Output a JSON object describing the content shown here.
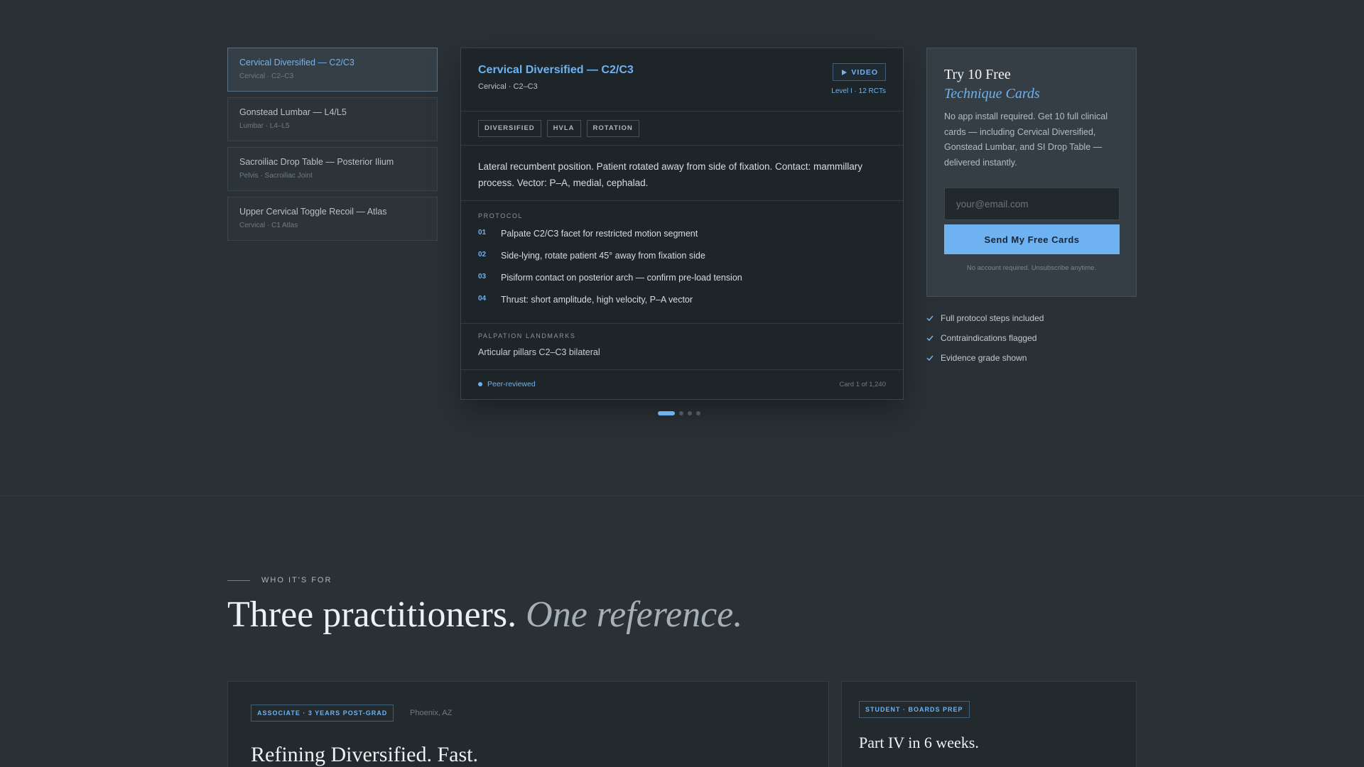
{
  "techniques": [
    {
      "title": "Cervical Diversified — C2/C3",
      "sub": "Cervical · C2–C3",
      "active": true
    },
    {
      "title": "Gonstead Lumbar — L4/L5",
      "sub": "Lumbar · L4–L5",
      "active": false
    },
    {
      "title": "Sacroiliac Drop Table — Posterior Ilium",
      "sub": "Pelvis · Sacroiliac Joint",
      "active": false
    },
    {
      "title": "Upper Cervical Toggle Recoil — Atlas",
      "sub": "Cervical · C1 Atlas",
      "active": false
    }
  ],
  "card": {
    "title": "Cervical Diversified — C2/C3",
    "subtitle": "Cervical · C2–C3",
    "video_label": "VIDEO",
    "level": "Level I · 12 RCTs",
    "tags": [
      "DIVERSIFIED",
      "HVLA",
      "ROTATION"
    ],
    "description": "Lateral recumbent position. Patient rotated away from side of fixation. Contact: mammillary process. Vector: P–A, medial, cephalad.",
    "protocol_label": "PROTOCOL",
    "steps": [
      {
        "num": "01",
        "text": "Palpate C2/C3 facet for restricted motion segment"
      },
      {
        "num": "02",
        "text": "Side-lying, rotate patient 45° away from fixation side"
      },
      {
        "num": "03",
        "text": "Pisiform contact on posterior arch — confirm pre-load tension"
      },
      {
        "num": "04",
        "text": "Thrust: short amplitude, high velocity, P–A vector"
      }
    ],
    "landmarks_label": "PALPATION LANDMARKS",
    "landmarks": "Articular pillars C2–C3 bilateral",
    "peer_label": "Peer-reviewed",
    "count": "Card 1 of 1,240"
  },
  "pager": {
    "total": 4,
    "active": 0
  },
  "signup": {
    "title_line1": "Try 10 Free",
    "title_line2": "Technique Cards",
    "body": "No app install required. Get 10 full clinical cards — including Cervical Diversified, Gonstead Lumbar, and SI Drop Table — delivered instantly.",
    "email_placeholder": "your@email.com",
    "button_label": "Send My Free Cards",
    "note": "No account required. Unsubscribe anytime."
  },
  "checklist": [
    "Full protocol steps included",
    "Contraindications flagged",
    "Evidence grade shown"
  ],
  "who": {
    "eyebrow": "WHO IT'S FOR",
    "headline_plain": "Three practitioners.",
    "headline_italic": "One reference."
  },
  "practitioners": [
    {
      "tag": "ASSOCIATE · 3 YEARS POST-GRAD",
      "location": "Phoenix, AZ",
      "title": "Refining Diversified. Fast."
    },
    {
      "tag": "STUDENT · BOARDS PREP",
      "location": "",
      "title": "Part IV in 6 weeks."
    }
  ],
  "colors": {
    "accent": "#6eb2f2",
    "background": "#2a3136",
    "card": "#1e2529"
  }
}
